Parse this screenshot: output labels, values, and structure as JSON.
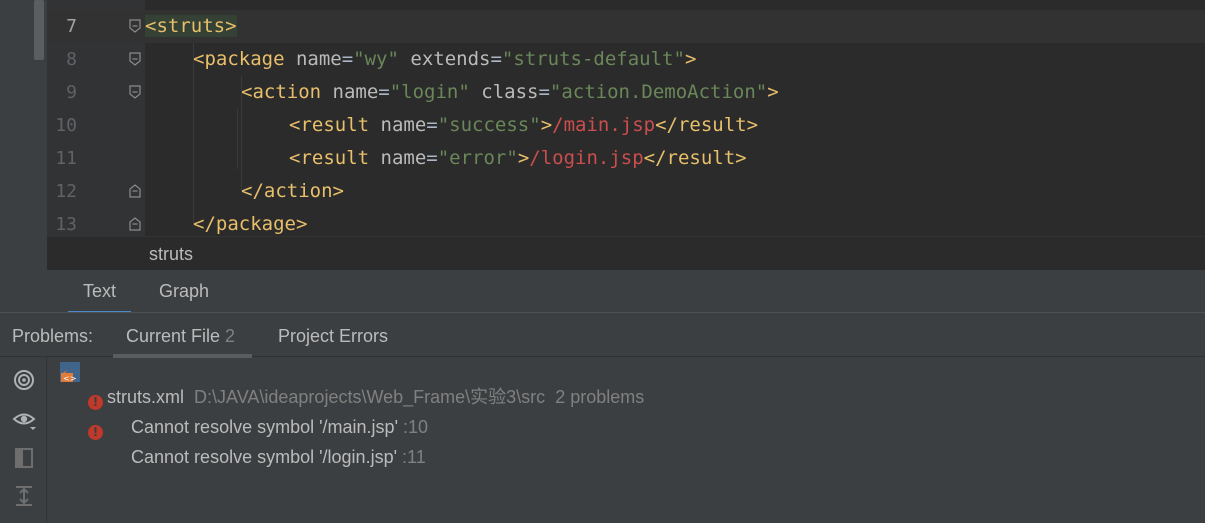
{
  "editor": {
    "lines": [
      {
        "num": "7",
        "current": true,
        "indent": 0,
        "parts": [
          [
            "tag",
            "<struts>"
          ]
        ],
        "highlight": true
      },
      {
        "num": "8",
        "indent": 1,
        "parts": [
          [
            "tag",
            "<package "
          ],
          [
            "attr",
            "name"
          ],
          [
            "txt",
            "="
          ],
          [
            "val",
            "\"wy\""
          ],
          [
            "attr",
            " extends"
          ],
          [
            "txt",
            "="
          ],
          [
            "val",
            "\"struts-default\""
          ],
          [
            "tag",
            ">"
          ]
        ]
      },
      {
        "num": "9",
        "indent": 2,
        "parts": [
          [
            "tag",
            "<action "
          ],
          [
            "attr",
            "name"
          ],
          [
            "txt",
            "="
          ],
          [
            "val",
            "\"login\""
          ],
          [
            "attr",
            " class"
          ],
          [
            "txt",
            "="
          ],
          [
            "val",
            "\"action.DemoAction\""
          ],
          [
            "tag",
            ">"
          ]
        ]
      },
      {
        "num": "10",
        "indent": 3,
        "parts": [
          [
            "tag",
            "<result "
          ],
          [
            "attr",
            "name"
          ],
          [
            "txt",
            "="
          ],
          [
            "val",
            "\"success\""
          ],
          [
            "tag",
            ">"
          ],
          [
            "url",
            "/main.jsp"
          ],
          [
            "tag",
            "</result>"
          ]
        ]
      },
      {
        "num": "11",
        "indent": 3,
        "parts": [
          [
            "tag",
            "<result "
          ],
          [
            "attr",
            "name"
          ],
          [
            "txt",
            "="
          ],
          [
            "val",
            "\"error\""
          ],
          [
            "tag",
            ">"
          ],
          [
            "url",
            "/login.jsp"
          ],
          [
            "tag",
            "</result>"
          ]
        ]
      },
      {
        "num": "12",
        "indent": 2,
        "parts": [
          [
            "tag",
            "</action>"
          ]
        ]
      },
      {
        "num": "13",
        "indent": 1,
        "parts": [
          [
            "tag",
            "</package>"
          ]
        ]
      }
    ]
  },
  "breadcrumb": {
    "label": "struts"
  },
  "editor_tabs": [
    {
      "label": "Text",
      "active": true
    },
    {
      "label": "Graph",
      "active": false
    }
  ],
  "problems": {
    "title": "Problems:",
    "tabs": [
      {
        "label": "Current File",
        "count": "2",
        "active": true
      },
      {
        "label": "Project Errors",
        "count": "",
        "active": false
      }
    ],
    "file": {
      "name": "struts.xml",
      "path": "D:\\JAVA\\ideaprojects\\Web_Frame\\实验3\\src",
      "summary": "2 problems"
    },
    "items": [
      {
        "message": "Cannot resolve symbol '/main.jsp'",
        "line": ":10"
      },
      {
        "message": "Cannot resolve symbol '/login.jsp'",
        "line": ":11"
      }
    ]
  },
  "tools": [
    "radar-icon",
    "eye-icon",
    "preview-icon",
    "expand-icon"
  ],
  "colors": {
    "background": "#2b2b2b",
    "panel": "#3c3f41",
    "tag": "#e8bf6a",
    "value": "#6a8759",
    "error": "#c0392b"
  }
}
